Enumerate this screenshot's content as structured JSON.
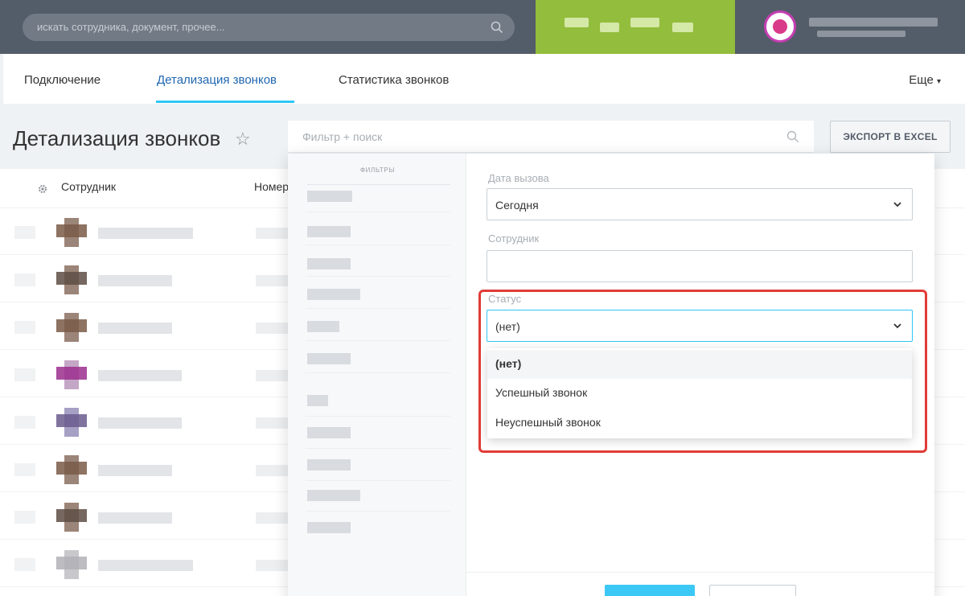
{
  "header": {
    "search_placeholder": "искать сотрудника, документ, прочее..."
  },
  "tabs": [
    {
      "label": "Подключение"
    },
    {
      "label": "Детализация звонков"
    },
    {
      "label": "Статистика звонков"
    }
  ],
  "more_label": "Еще",
  "page": {
    "title": "Детализация звонков",
    "filter_placeholder": "Фильтр + поиск",
    "export_label": "ЭКСПОРТ В EXCEL"
  },
  "table": {
    "columns": [
      "Сотрудник",
      "Номер"
    ]
  },
  "filter": {
    "title": "ФИЛЬТРЫ",
    "call_date_label": "Дата вызова",
    "call_date_value": "Сегодня",
    "employee_label": "Сотрудник",
    "status_label": "Статус",
    "status_value": "(нет)",
    "status_options": [
      "(нет)",
      "Успешный звонок",
      "Неуспешный звонок"
    ]
  },
  "colors": {
    "header_bg": "#535c69",
    "accent": "#2fc6f6",
    "highlight": "#e03c36",
    "brand_green": "#93bd3c"
  }
}
